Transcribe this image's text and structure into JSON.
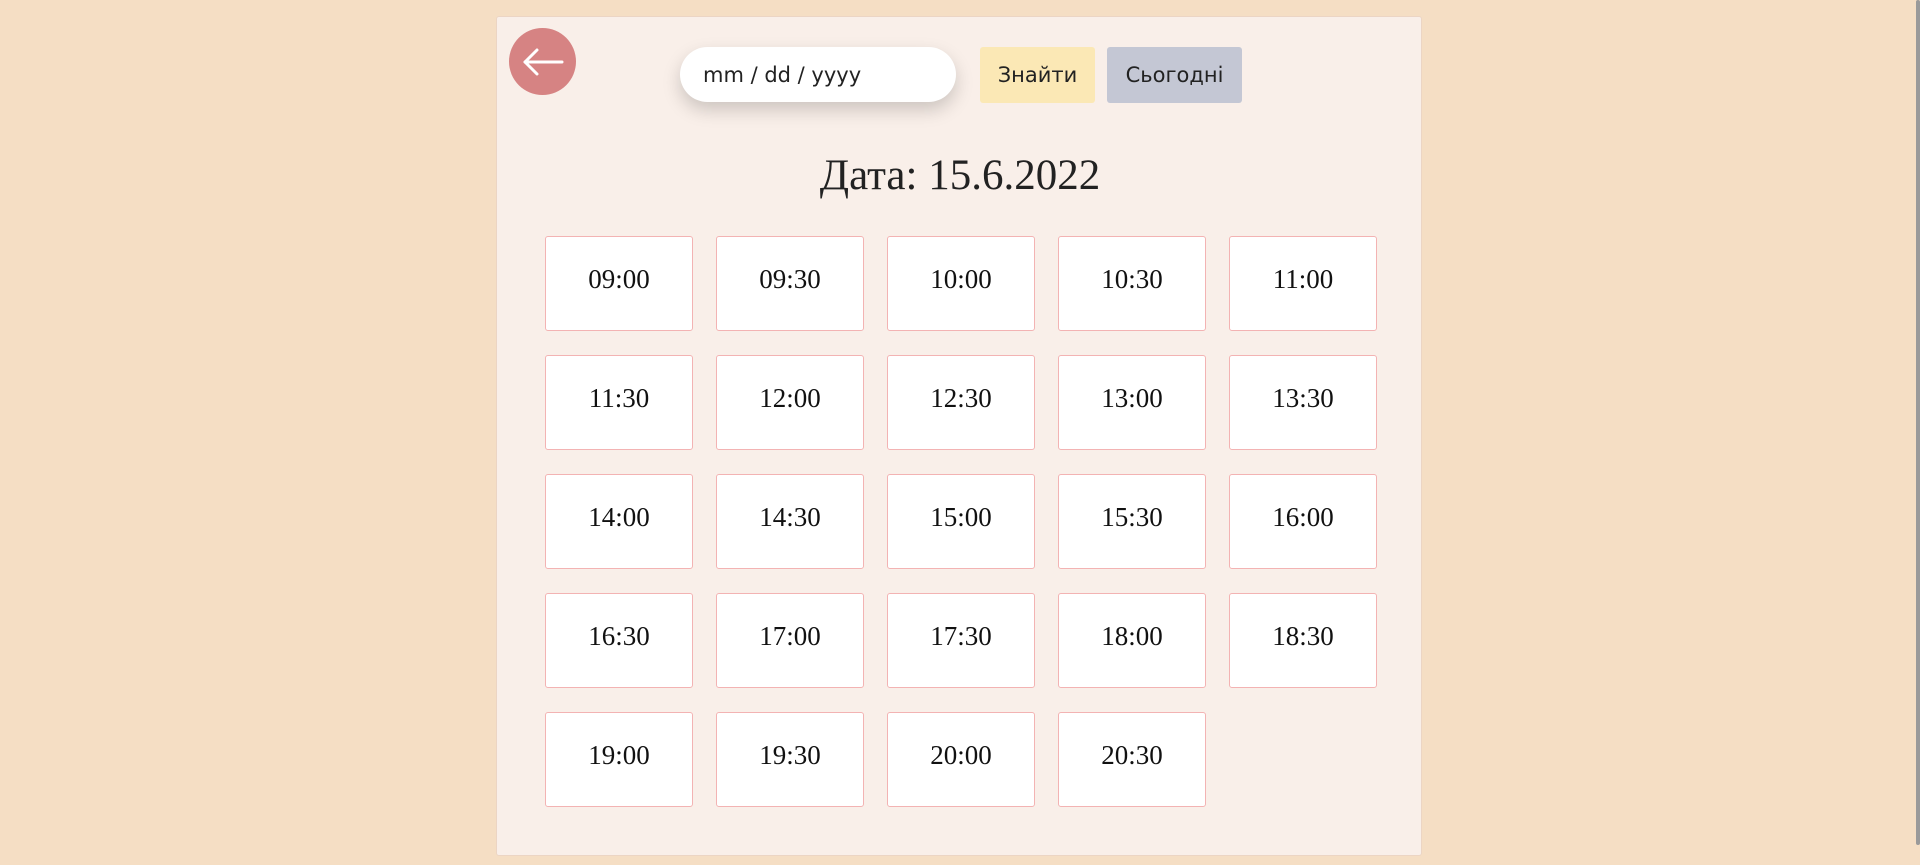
{
  "header": {
    "date_placeholder": "mm / dd / yyyy",
    "find_label": "Знайти",
    "today_label": "Сьогодні",
    "back_icon": "arrow-left-icon"
  },
  "main": {
    "date_title": "Дата: 15.6.2022",
    "slots": [
      "09:00",
      "09:30",
      "10:00",
      "10:30",
      "11:00",
      "11:30",
      "12:00",
      "12:30",
      "13:00",
      "13:30",
      "14:00",
      "14:30",
      "15:00",
      "15:30",
      "16:00",
      "16:30",
      "17:00",
      "17:30",
      "18:00",
      "18:30",
      "19:00",
      "19:30",
      "20:00",
      "20:30"
    ]
  },
  "colors": {
    "page_background": "#f5dec4",
    "panel_background": "#f9efe9",
    "back_button": "#d68383",
    "find_button": "#fbe8b5",
    "today_button": "#c4c7d4",
    "slot_border": "#f3b3b3"
  }
}
